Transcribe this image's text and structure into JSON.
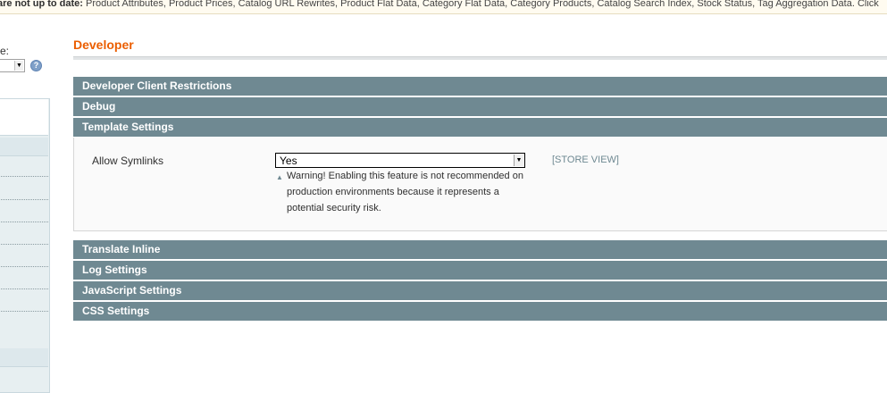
{
  "notice": {
    "lead": "are not up to date:",
    "items": "Product Attributes, Product Prices, Catalog URL Rewrites, Product Flat Data, Category Flat Data, Category Products, Catalog Search Index, Stock Status, Tag Aggregation Data. Click"
  },
  "sidebar": {
    "scope_label": "e:",
    "help_icon": "?"
  },
  "page": {
    "title": "Developer"
  },
  "sections": [
    {
      "label": "Developer Client Restrictions"
    },
    {
      "label": "Debug"
    },
    {
      "label": "Template Settings"
    },
    {
      "label": "Translate Inline"
    },
    {
      "label": "Log Settings"
    },
    {
      "label": "JavaScript Settings"
    },
    {
      "label": "CSS Settings"
    }
  ],
  "template_settings": {
    "allow_symlinks": {
      "label": "Allow Symlinks",
      "value": "Yes",
      "scope": "[STORE VIEW]",
      "warning": "Warning! Enabling this feature is not recommended on production environments because it represents a potential security risk."
    }
  },
  "icons": {
    "dropdown_arrow": "chevron-down-icon",
    "help": "help-icon",
    "warning": "warning-triangle-icon"
  },
  "colors": {
    "title": "#eb5e00",
    "section_header": "#6f8992"
  }
}
